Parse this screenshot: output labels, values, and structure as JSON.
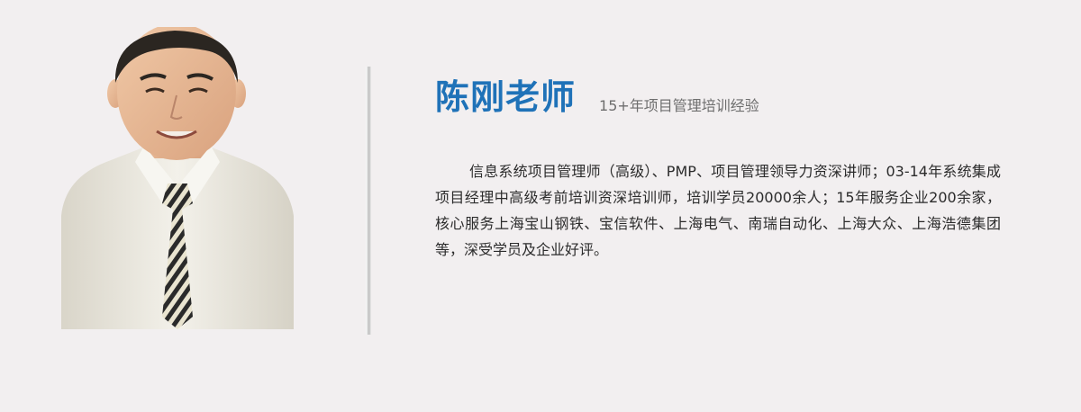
{
  "profile": {
    "name": "陈刚老师",
    "subtitle": "15+年项目管理培训经验",
    "bio": "信息系统项目管理师（高级）、PMP、项目管理领导力资深讲师；03-14年系统集成项目经理中高级考前培训资深培训师，培训学员20000余人；15年服务企业200余家，核心服务上海宝山钢铁、宝信软件、上海电气、南瑞自动化、上海大众、上海浩德集团等，深受学员及企业好评。"
  },
  "colors": {
    "background": "#f2eff0",
    "name": "#1f72b8",
    "subtitle": "#6e6e6e",
    "body_text": "#2b2b2b"
  }
}
